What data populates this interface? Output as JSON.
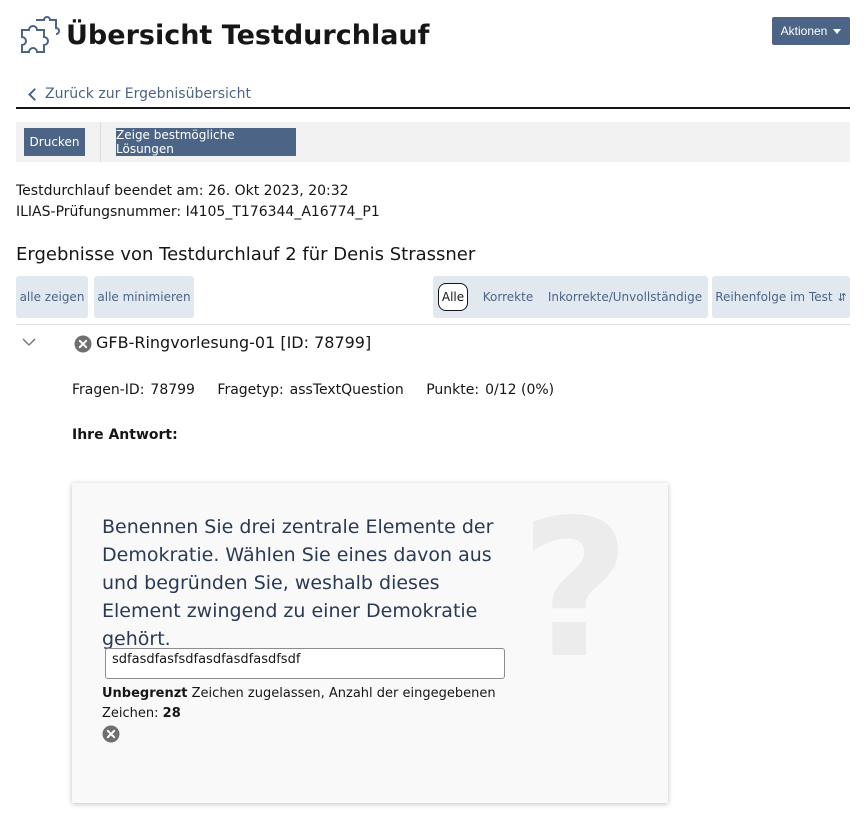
{
  "header": {
    "title": "Übersicht Testdurchlauf",
    "actions_label": "Aktionen"
  },
  "nav": {
    "back_label": "Zurück zur Ergebnisübersicht"
  },
  "toolbar": {
    "print_label": "Drucken",
    "best_solutions_label": "Zeige bestmögliche Lösungen"
  },
  "meta": {
    "finished_line": "Testdurchlauf beendet am: 26. Okt 2023, 20:32",
    "exam_number_line": "ILIAS-Prüfungsnummer: I4105_T176344_A16774_P1"
  },
  "results": {
    "title": "Ergebnisse von Testdurchlauf 2 für Denis Strassner",
    "show_all_label": "alle zeigen",
    "minimize_all_label": "alle minimieren",
    "filters": [
      "Alle",
      "Korrekte",
      "Inkorrekte/Unvollständige"
    ],
    "active_filter": "Alle",
    "sort_label": "Reihenfolge im Test"
  },
  "question": {
    "title": "GFB-Ringvorlesung-01 [ID: 78799]",
    "id_label": "Fragen-ID:",
    "id_value": "78799",
    "type_label": "Fragetyp:",
    "type_value": "assTextQuestion",
    "points_label": "Punkte:",
    "points_value": "0/12 (0%)",
    "answer_label": "Ihre Antwort:",
    "text": "Benennen Sie drei zentrale Elemente der Demokratie. Wählen Sie eines davon aus und begründen Sie, weshalb dieses Element zwingend zu einer Demokratie gehört.",
    "answer_value": "sdfasdfasfsdfasdfasdfasdfsdf",
    "char_limit": "Unbegrenzt",
    "char_info_text": "Zeichen zugelassen, Anzahl der eingegebenen Zeichen:",
    "char_count": "28",
    "status": "incorrect"
  },
  "colors": {
    "primary": "#4c6586",
    "control_bg": "#e2e8ef",
    "toolbar_bg": "#f2f2f2",
    "text": "#161616",
    "icon_gray": "#6f6f6f"
  }
}
